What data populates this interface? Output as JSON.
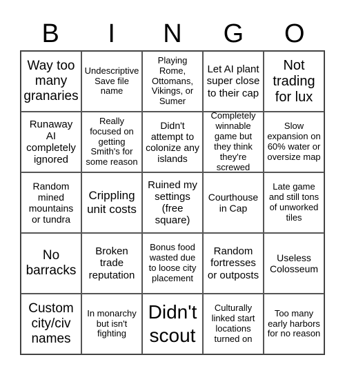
{
  "title_letters": [
    "B",
    "I",
    "N",
    "G",
    "O"
  ],
  "cells": [
    {
      "text": "Way too many granaries"
    },
    {
      "text": "Undescriptive Save file name"
    },
    {
      "text": "Playing Rome, Ottomans, Vikings, or Sumer"
    },
    {
      "text": "Let AI plant super close to their cap"
    },
    {
      "text": "Not trading for lux"
    },
    {
      "text": "Runaway AI completely ignored"
    },
    {
      "text": "Really focused on getting Smith's for some reason"
    },
    {
      "text": "Didn't attempt to colonize any islands"
    },
    {
      "text": "Completely winnable game but they think they're screwed"
    },
    {
      "text": "Slow expansion on 60% water or oversize map"
    },
    {
      "text": "Random mined mountains or tundra"
    },
    {
      "text": "Crippling unit costs"
    },
    {
      "text": "Ruined my settings (free square)"
    },
    {
      "text": "Courthouse in Cap"
    },
    {
      "text": "Late game and still tons of unworked tiles"
    },
    {
      "text": "No barracks"
    },
    {
      "text": "Broken trade reputation"
    },
    {
      "text": "Bonus food wasted due to loose city placement"
    },
    {
      "text": "Random fortresses or outposts"
    },
    {
      "text": "Useless Colosseum"
    },
    {
      "text": "Custom city/civ names"
    },
    {
      "text": "In monarchy but isn't fighting"
    },
    {
      "text": "Didn't scout"
    },
    {
      "text": "Culturally linked start locations turned on"
    },
    {
      "text": "Too many early harbors for no reason"
    }
  ]
}
